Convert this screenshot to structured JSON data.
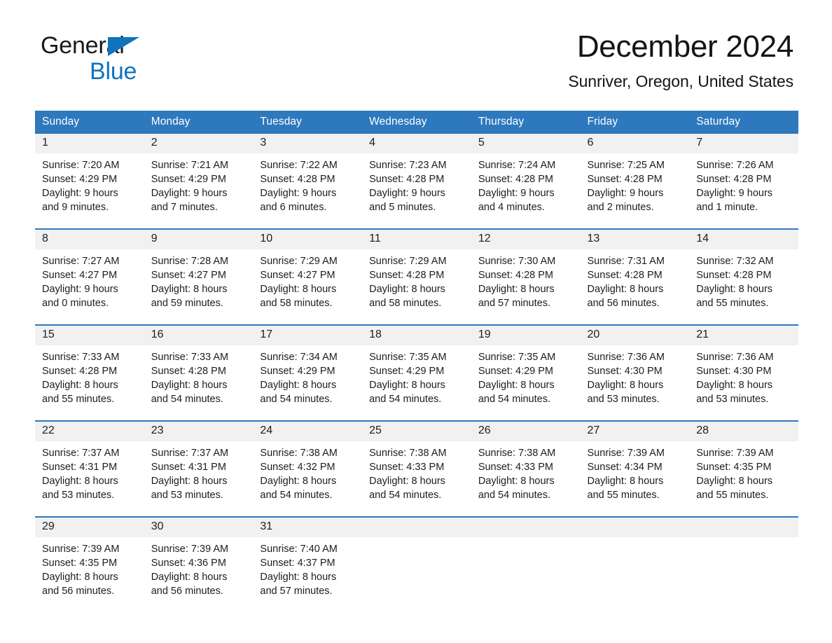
{
  "brand": {
    "name_part1": "General",
    "name_part2": "Blue",
    "accent_color": "#1173bd"
  },
  "header": {
    "month_title": "December 2024",
    "location": "Sunriver, Oregon, United States"
  },
  "theme": {
    "header_blue": "#2e78bd",
    "daynum_bg": "#f1f1f1",
    "text": "#1d1d1d"
  },
  "weekday_headers": [
    "Sunday",
    "Monday",
    "Tuesday",
    "Wednesday",
    "Thursday",
    "Friday",
    "Saturday"
  ],
  "weeks": [
    [
      {
        "day": "1",
        "sunrise": "Sunrise: 7:20 AM",
        "sunset": "Sunset: 4:29 PM",
        "daylight_line1": "Daylight: 9 hours",
        "daylight_line2": "and 9 minutes."
      },
      {
        "day": "2",
        "sunrise": "Sunrise: 7:21 AM",
        "sunset": "Sunset: 4:29 PM",
        "daylight_line1": "Daylight: 9 hours",
        "daylight_line2": "and 7 minutes."
      },
      {
        "day": "3",
        "sunrise": "Sunrise: 7:22 AM",
        "sunset": "Sunset: 4:28 PM",
        "daylight_line1": "Daylight: 9 hours",
        "daylight_line2": "and 6 minutes."
      },
      {
        "day": "4",
        "sunrise": "Sunrise: 7:23 AM",
        "sunset": "Sunset: 4:28 PM",
        "daylight_line1": "Daylight: 9 hours",
        "daylight_line2": "and 5 minutes."
      },
      {
        "day": "5",
        "sunrise": "Sunrise: 7:24 AM",
        "sunset": "Sunset: 4:28 PM",
        "daylight_line1": "Daylight: 9 hours",
        "daylight_line2": "and 4 minutes."
      },
      {
        "day": "6",
        "sunrise": "Sunrise: 7:25 AM",
        "sunset": "Sunset: 4:28 PM",
        "daylight_line1": "Daylight: 9 hours",
        "daylight_line2": "and 2 minutes."
      },
      {
        "day": "7",
        "sunrise": "Sunrise: 7:26 AM",
        "sunset": "Sunset: 4:28 PM",
        "daylight_line1": "Daylight: 9 hours",
        "daylight_line2": "and 1 minute."
      }
    ],
    [
      {
        "day": "8",
        "sunrise": "Sunrise: 7:27 AM",
        "sunset": "Sunset: 4:27 PM",
        "daylight_line1": "Daylight: 9 hours",
        "daylight_line2": "and 0 minutes."
      },
      {
        "day": "9",
        "sunrise": "Sunrise: 7:28 AM",
        "sunset": "Sunset: 4:27 PM",
        "daylight_line1": "Daylight: 8 hours",
        "daylight_line2": "and 59 minutes."
      },
      {
        "day": "10",
        "sunrise": "Sunrise: 7:29 AM",
        "sunset": "Sunset: 4:27 PM",
        "daylight_line1": "Daylight: 8 hours",
        "daylight_line2": "and 58 minutes."
      },
      {
        "day": "11",
        "sunrise": "Sunrise: 7:29 AM",
        "sunset": "Sunset: 4:28 PM",
        "daylight_line1": "Daylight: 8 hours",
        "daylight_line2": "and 58 minutes."
      },
      {
        "day": "12",
        "sunrise": "Sunrise: 7:30 AM",
        "sunset": "Sunset: 4:28 PM",
        "daylight_line1": "Daylight: 8 hours",
        "daylight_line2": "and 57 minutes."
      },
      {
        "day": "13",
        "sunrise": "Sunrise: 7:31 AM",
        "sunset": "Sunset: 4:28 PM",
        "daylight_line1": "Daylight: 8 hours",
        "daylight_line2": "and 56 minutes."
      },
      {
        "day": "14",
        "sunrise": "Sunrise: 7:32 AM",
        "sunset": "Sunset: 4:28 PM",
        "daylight_line1": "Daylight: 8 hours",
        "daylight_line2": "and 55 minutes."
      }
    ],
    [
      {
        "day": "15",
        "sunrise": "Sunrise: 7:33 AM",
        "sunset": "Sunset: 4:28 PM",
        "daylight_line1": "Daylight: 8 hours",
        "daylight_line2": "and 55 minutes."
      },
      {
        "day": "16",
        "sunrise": "Sunrise: 7:33 AM",
        "sunset": "Sunset: 4:28 PM",
        "daylight_line1": "Daylight: 8 hours",
        "daylight_line2": "and 54 minutes."
      },
      {
        "day": "17",
        "sunrise": "Sunrise: 7:34 AM",
        "sunset": "Sunset: 4:29 PM",
        "daylight_line1": "Daylight: 8 hours",
        "daylight_line2": "and 54 minutes."
      },
      {
        "day": "18",
        "sunrise": "Sunrise: 7:35 AM",
        "sunset": "Sunset: 4:29 PM",
        "daylight_line1": "Daylight: 8 hours",
        "daylight_line2": "and 54 minutes."
      },
      {
        "day": "19",
        "sunrise": "Sunrise: 7:35 AM",
        "sunset": "Sunset: 4:29 PM",
        "daylight_line1": "Daylight: 8 hours",
        "daylight_line2": "and 54 minutes."
      },
      {
        "day": "20",
        "sunrise": "Sunrise: 7:36 AM",
        "sunset": "Sunset: 4:30 PM",
        "daylight_line1": "Daylight: 8 hours",
        "daylight_line2": "and 53 minutes."
      },
      {
        "day": "21",
        "sunrise": "Sunrise: 7:36 AM",
        "sunset": "Sunset: 4:30 PM",
        "daylight_line1": "Daylight: 8 hours",
        "daylight_line2": "and 53 minutes."
      }
    ],
    [
      {
        "day": "22",
        "sunrise": "Sunrise: 7:37 AM",
        "sunset": "Sunset: 4:31 PM",
        "daylight_line1": "Daylight: 8 hours",
        "daylight_line2": "and 53 minutes."
      },
      {
        "day": "23",
        "sunrise": "Sunrise: 7:37 AM",
        "sunset": "Sunset: 4:31 PM",
        "daylight_line1": "Daylight: 8 hours",
        "daylight_line2": "and 53 minutes."
      },
      {
        "day": "24",
        "sunrise": "Sunrise: 7:38 AM",
        "sunset": "Sunset: 4:32 PM",
        "daylight_line1": "Daylight: 8 hours",
        "daylight_line2": "and 54 minutes."
      },
      {
        "day": "25",
        "sunrise": "Sunrise: 7:38 AM",
        "sunset": "Sunset: 4:33 PM",
        "daylight_line1": "Daylight: 8 hours",
        "daylight_line2": "and 54 minutes."
      },
      {
        "day": "26",
        "sunrise": "Sunrise: 7:38 AM",
        "sunset": "Sunset: 4:33 PM",
        "daylight_line1": "Daylight: 8 hours",
        "daylight_line2": "and 54 minutes."
      },
      {
        "day": "27",
        "sunrise": "Sunrise: 7:39 AM",
        "sunset": "Sunset: 4:34 PM",
        "daylight_line1": "Daylight: 8 hours",
        "daylight_line2": "and 55 minutes."
      },
      {
        "day": "28",
        "sunrise": "Sunrise: 7:39 AM",
        "sunset": "Sunset: 4:35 PM",
        "daylight_line1": "Daylight: 8 hours",
        "daylight_line2": "and 55 minutes."
      }
    ],
    [
      {
        "day": "29",
        "sunrise": "Sunrise: 7:39 AM",
        "sunset": "Sunset: 4:35 PM",
        "daylight_line1": "Daylight: 8 hours",
        "daylight_line2": "and 56 minutes."
      },
      {
        "day": "30",
        "sunrise": "Sunrise: 7:39 AM",
        "sunset": "Sunset: 4:36 PM",
        "daylight_line1": "Daylight: 8 hours",
        "daylight_line2": "and 56 minutes."
      },
      {
        "day": "31",
        "sunrise": "Sunrise: 7:40 AM",
        "sunset": "Sunset: 4:37 PM",
        "daylight_line1": "Daylight: 8 hours",
        "daylight_line2": "and 57 minutes."
      },
      {
        "day": "",
        "sunrise": "",
        "sunset": "",
        "daylight_line1": "",
        "daylight_line2": ""
      },
      {
        "day": "",
        "sunrise": "",
        "sunset": "",
        "daylight_line1": "",
        "daylight_line2": ""
      },
      {
        "day": "",
        "sunrise": "",
        "sunset": "",
        "daylight_line1": "",
        "daylight_line2": ""
      },
      {
        "day": "",
        "sunrise": "",
        "sunset": "",
        "daylight_line1": "",
        "daylight_line2": ""
      }
    ]
  ]
}
